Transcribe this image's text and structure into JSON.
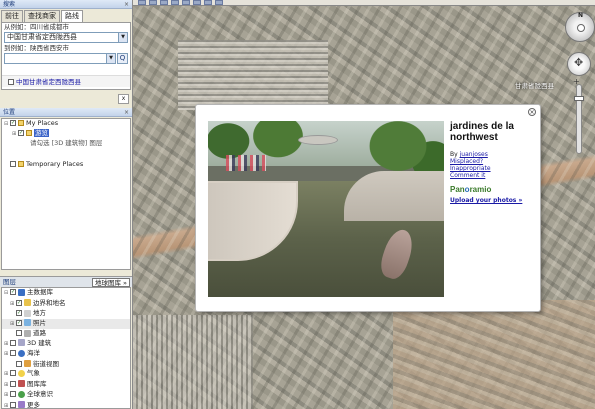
{
  "left_panel": {
    "search_pane_title": "搜索",
    "tabs": [
      "前往",
      "查找商家",
      "路线"
    ],
    "from_label": "从例如：四川省成都市",
    "from_value": "中国甘肃省定西陇西县",
    "to_label": "到例如：陕西省西安市",
    "to_value": "",
    "search_button": "Q",
    "result_text": "中国甘肃省定西陇西县",
    "close_x": "x",
    "places_title": "位置",
    "my_places": "My Places",
    "sightseeing": "游览",
    "sightseeing_sub": "请勾选 [3D 建筑物] 图层",
    "temporary_places": "Temporary Places",
    "layers_title": "图层",
    "gallery_button": "地球图库 »",
    "layers": [
      "主数据库",
      "边界和地名",
      "地方",
      "照片",
      "道路",
      "3D 建筑",
      "海洋",
      "街道视图",
      "气象",
      "图库库",
      "全球意识",
      "更多"
    ]
  },
  "map": {
    "place_label": "甘肃省陇西县",
    "compass_n": "N"
  },
  "balloon": {
    "title": "jardines de la northwest",
    "by_label": "By",
    "author": "juanjoses",
    "misplaced": "Misplaced?",
    "inappropriate": "Inappropriate",
    "comment": "Comment it",
    "brand_pan": "Pan",
    "brand_o": "o",
    "brand_ramio": "ramio",
    "upload": "Upload your photos »",
    "close": "×"
  },
  "colors": {
    "link": "#1a1aa6",
    "panoramio_green": "#3a7a2a",
    "selection_blue": "#3a63c8"
  }
}
